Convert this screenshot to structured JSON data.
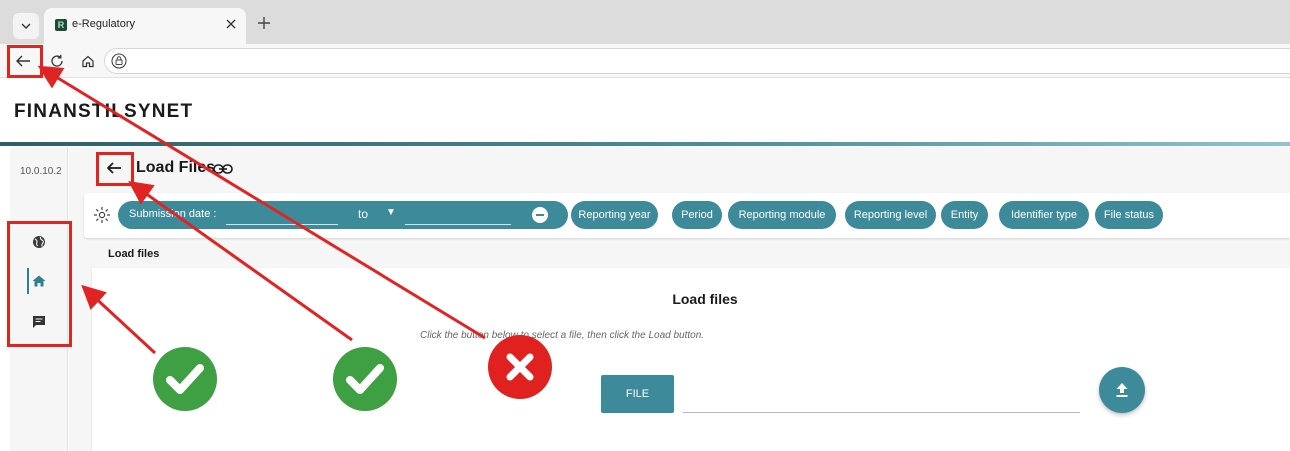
{
  "browser": {
    "tab_title": "e-Regulatory",
    "favicon_letter": "R",
    "icons": [
      "tab-list-chevron-icon",
      "close-icon",
      "plus-icon",
      "back-arrow-icon",
      "reload-icon",
      "home-icon",
      "site-info-lock-icon"
    ]
  },
  "header": {
    "logo_text": "FINANSTILSYNET"
  },
  "sidebar": {
    "version": "10.0.10.2",
    "items": [
      {
        "icon": "globe-icon"
      },
      {
        "icon": "home-icon",
        "active": true
      },
      {
        "icon": "chat-message-icon"
      }
    ]
  },
  "page": {
    "title": "Load Files",
    "title_icons": [
      "back-arrow-icon",
      "link-icon"
    ]
  },
  "filters": {
    "date_label": "Submission date :",
    "date_to": "to",
    "chips": [
      "Reporting year",
      "Period",
      "Reporting module",
      "Reporting level",
      "Entity",
      "Identifier type",
      "File status"
    ]
  },
  "section": {
    "label": "Load files"
  },
  "panel": {
    "title": "Load files",
    "description": "Click the button below to select a file, then click the Load button.",
    "file_button": "FILE",
    "upload_icon": "upload-icon"
  },
  "annotations": {
    "color": "#e02424",
    "marks": [
      {
        "type": "check",
        "color": "#3ea043"
      },
      {
        "type": "check",
        "color": "#3ea043"
      },
      {
        "type": "cross",
        "color": "#e0211f"
      }
    ]
  },
  "colors": {
    "accent": "#3d8b9a",
    "sidebar_active": "#2f7f91"
  }
}
